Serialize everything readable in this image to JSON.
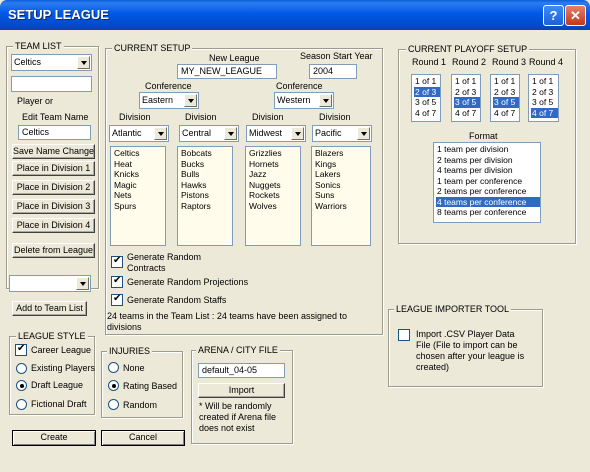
{
  "window": {
    "title": "SETUP LEAGUE"
  },
  "team_list": {
    "group_title": "TEAM LIST",
    "selected_team": "Celtics",
    "text_input": "",
    "player_or_label": "Player or",
    "edit_team_name_label": "Edit Team Name",
    "team_name_value": "Celtics",
    "buttons": {
      "save_name_change": "Save Name Change",
      "place_div1": "Place in Division 1",
      "place_div2": "Place in Division 2",
      "place_div3": "Place in Division 3",
      "place_div4": "Place in Division 4",
      "delete_from_league": "Delete from League"
    },
    "add_combo_value": "",
    "add_to_team_list": "Add to Team List"
  },
  "current_setup": {
    "group_title": "CURRENT SETUP",
    "new_league_label": "New League",
    "new_league_value": "MY_NEW_LEAGUE",
    "season_start_label": "Season Start Year",
    "season_start_value": "2004",
    "conference_label": "Conference",
    "conference_left": "Eastern",
    "conference_right": "Western",
    "division_label": "Division",
    "divisions": [
      {
        "name": "Atlantic",
        "teams": [
          "Celtics",
          "Heat",
          "Knicks",
          "Magic",
          "Nets",
          "Spurs"
        ]
      },
      {
        "name": "Central",
        "teams": [
          "Bobcats",
          "Bucks",
          "Bulls",
          "Hawks",
          "Pistons",
          "Raptors"
        ]
      },
      {
        "name": "Midwest",
        "teams": [
          "Grizzlies",
          "Hornets",
          "Jazz",
          "Nuggets",
          "Rockets",
          "Wolves"
        ]
      },
      {
        "name": "Pacific",
        "teams": [
          "Blazers",
          "Kings",
          "Lakers",
          "Sonics",
          "Suns",
          "Warriors"
        ]
      }
    ],
    "options": {
      "random_contracts_line1": "Generate Random",
      "random_contracts_line2": "Contracts",
      "random_projections": "Generate Random Projections",
      "random_staffs": "Generate Random Staffs"
    },
    "status_line1": "24 teams in the Team List : 24 teams have been assigned to",
    "status_line2": "divisions"
  },
  "playoff_setup": {
    "group_title": "CURRENT PLAYOFF SETUP",
    "rounds": [
      {
        "label": "Round 1",
        "options": [
          "1 of 1",
          "2 of 3",
          "3 of 5",
          "4 of 7"
        ],
        "selected": 1
      },
      {
        "label": "Round 2",
        "options": [
          "1 of 1",
          "2 of 3",
          "3 of 5",
          "4 of 7"
        ],
        "selected": 2
      },
      {
        "label": "Round 3",
        "options": [
          "1 of 1",
          "2 of 3",
          "3 of 5",
          "4 of 7"
        ],
        "selected": 2
      },
      {
        "label": "Round 4",
        "options": [
          "1 of 1",
          "2 of 3",
          "3 of 5",
          "4 of 7"
        ],
        "selected": 3
      }
    ],
    "format_label": "Format",
    "formats": [
      "1 team per division",
      "2 teams per division",
      "4 teams per division",
      "1 team per conference",
      "2 teams per conference",
      "4 teams per conference",
      "8 teams per conference"
    ],
    "format_selected": 5
  },
  "importer": {
    "group_title": "LEAGUE IMPORTER TOOL",
    "line1": "Import .CSV Player Data",
    "line2": "File  (File to import can be",
    "line3": "chosen after your league is",
    "line4": "created)"
  },
  "league_style": {
    "group_title": "LEAGUE STYLE",
    "career_league": "Career League",
    "existing_players": "Existing Players",
    "draft_league": "Draft League",
    "fictional_draft": "Fictional Draft"
  },
  "injuries": {
    "group_title": "INJURIES",
    "none": "None",
    "rating_based": "Rating Based",
    "random": "Random"
  },
  "arena": {
    "group_title": "ARENA / CITY FILE",
    "file_value": "default_04-05",
    "import_button": "Import",
    "note_line1": "* Will be randomly",
    "note_line2": "created if Arena file",
    "note_line3": "does not exist"
  },
  "footer": {
    "create": "Create",
    "cancel": "Cancel"
  }
}
